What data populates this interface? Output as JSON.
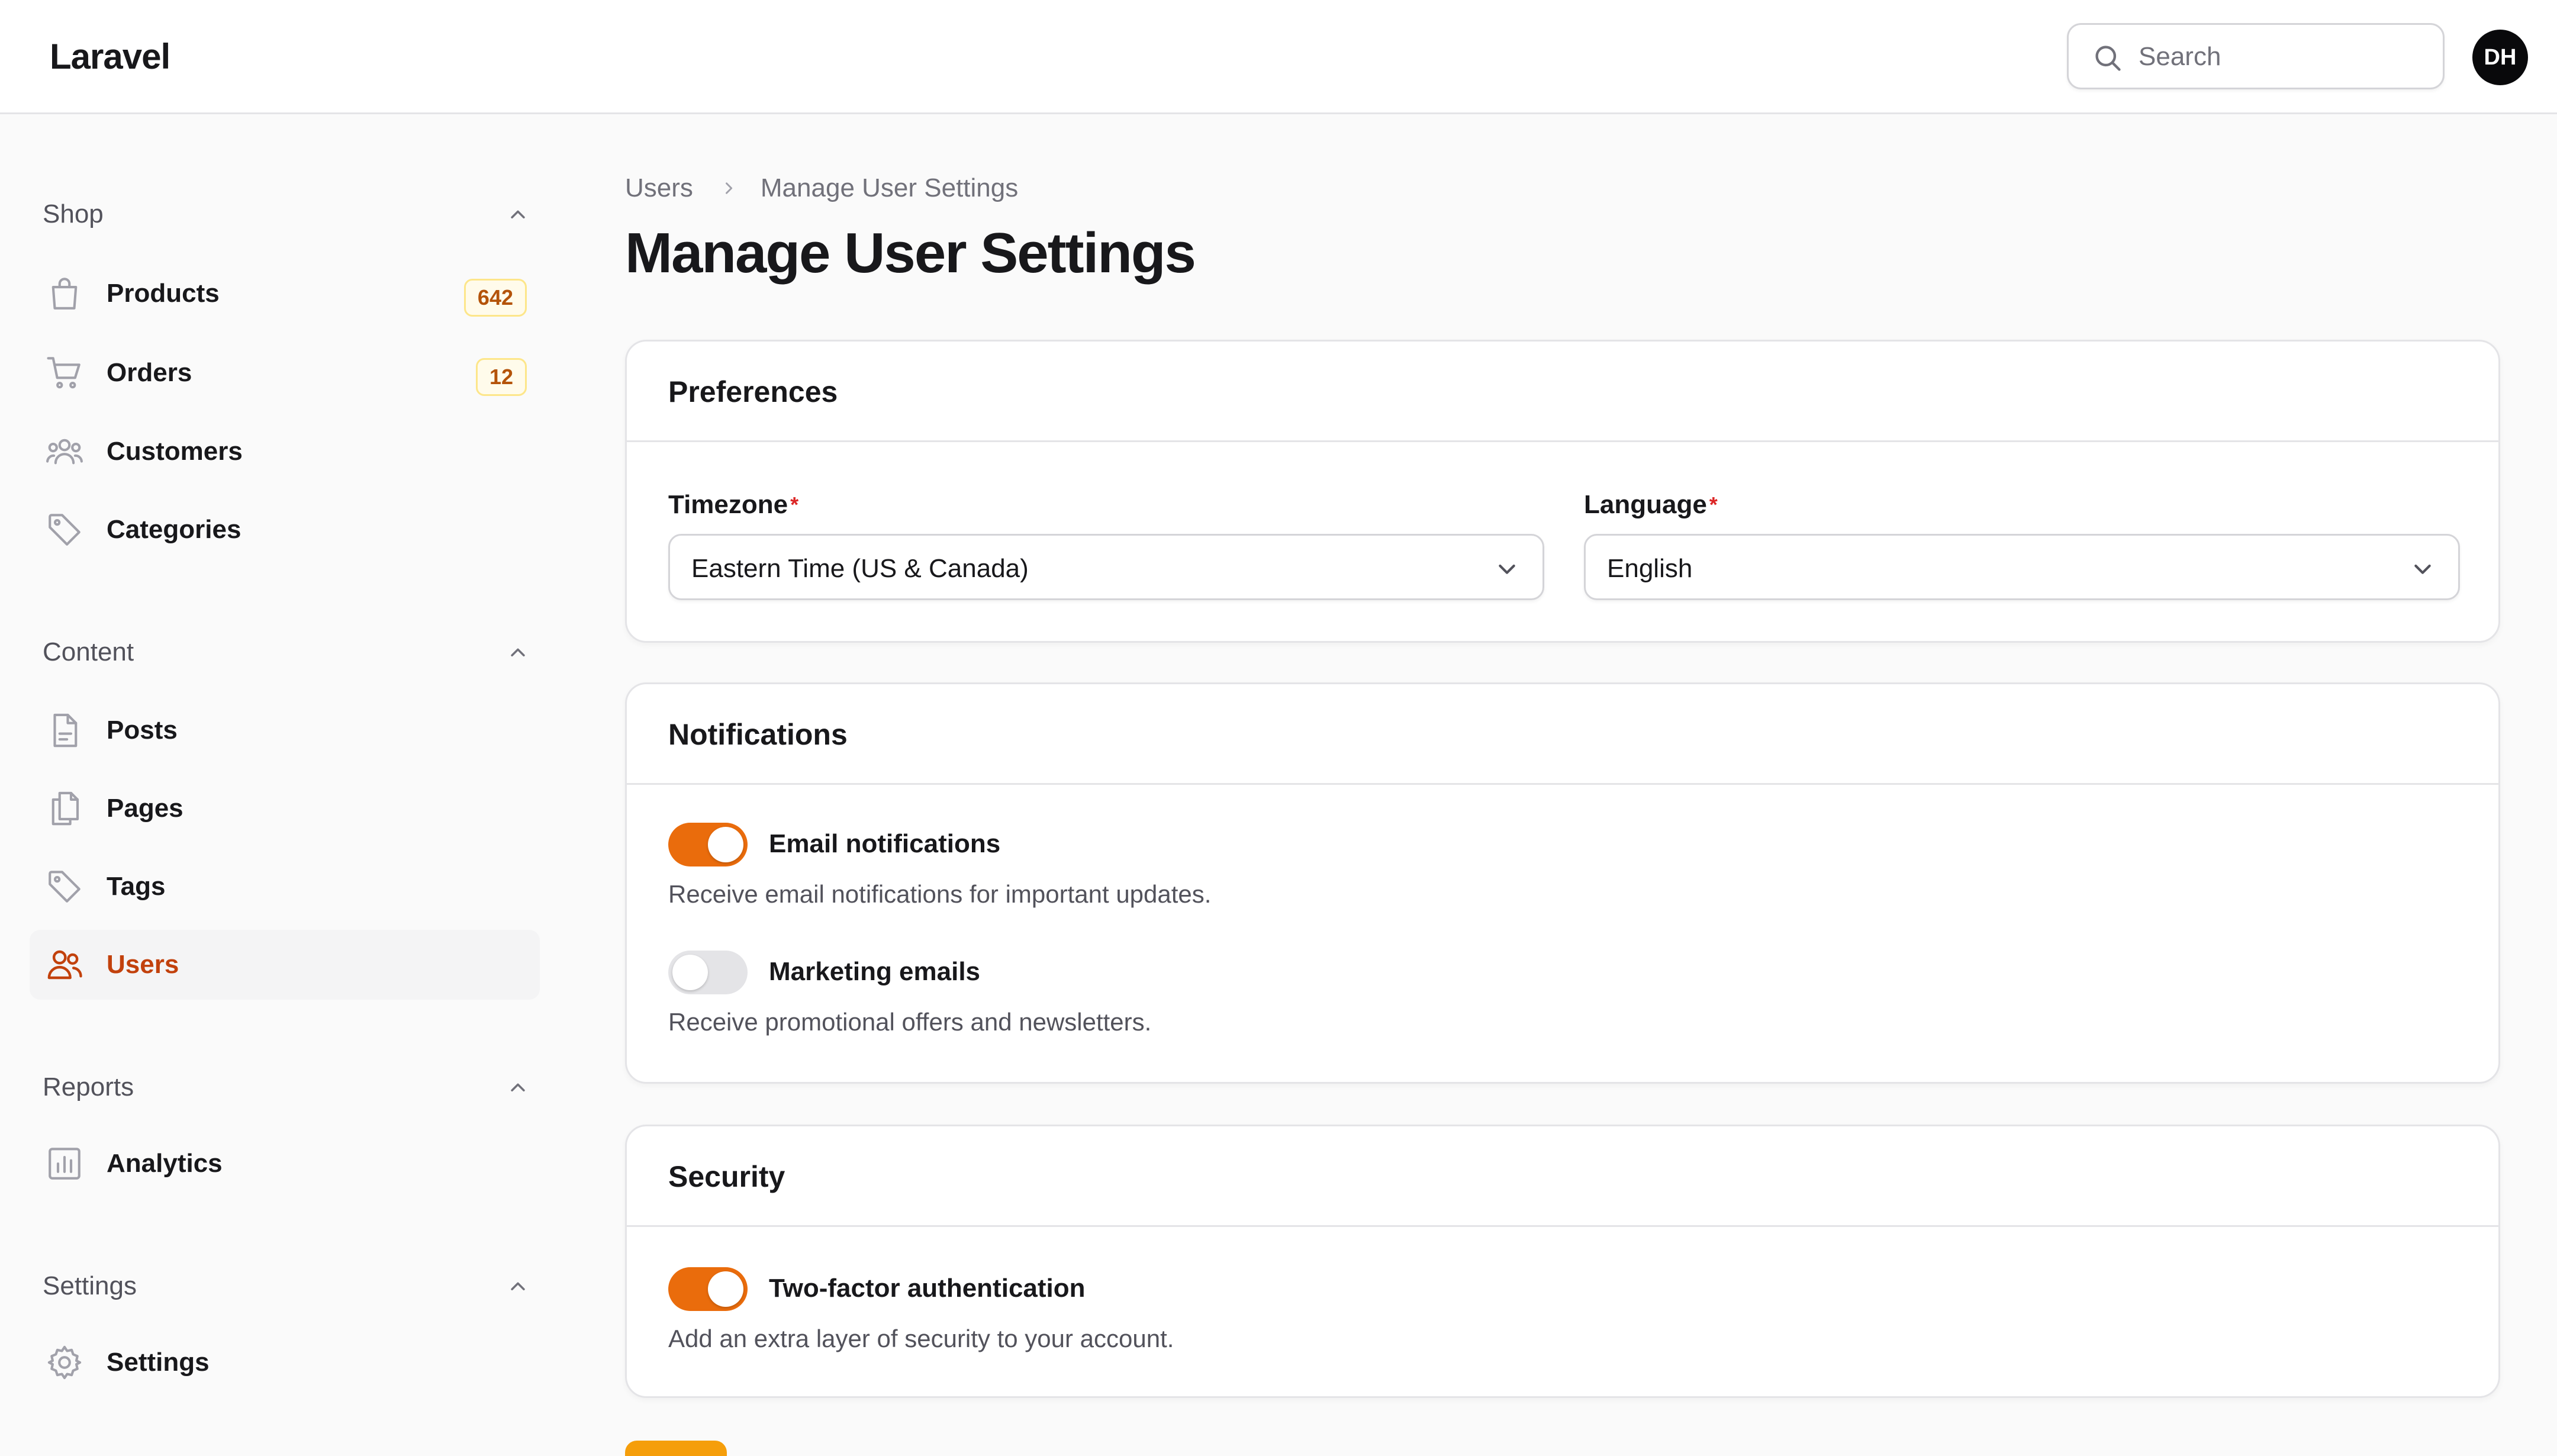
{
  "app": {
    "brand": "Laravel"
  },
  "topbar": {
    "search_placeholder": "Search",
    "avatar_initials": "DH"
  },
  "sidebar": {
    "groups": [
      {
        "label": "Shop",
        "items": [
          {
            "label": "Products",
            "badge": "642",
            "icon": "shopping-bag-icon"
          },
          {
            "label": "Orders",
            "badge": "12",
            "icon": "shopping-cart-icon"
          },
          {
            "label": "Customers",
            "icon": "users-group-icon"
          },
          {
            "label": "Categories",
            "icon": "tag-icon"
          }
        ]
      },
      {
        "label": "Content",
        "items": [
          {
            "label": "Posts",
            "icon": "document-icon"
          },
          {
            "label": "Pages",
            "icon": "documents-icon"
          },
          {
            "label": "Tags",
            "icon": "tag-icon"
          },
          {
            "label": "Users",
            "icon": "users-icon",
            "active": true
          }
        ]
      },
      {
        "label": "Reports",
        "items": [
          {
            "label": "Analytics",
            "icon": "chart-bar-icon"
          }
        ]
      },
      {
        "label": "Settings",
        "items": [
          {
            "label": "Settings",
            "icon": "gear-icon"
          }
        ]
      }
    ]
  },
  "breadcrumb": {
    "parent": "Users",
    "current": "Manage User Settings"
  },
  "page": {
    "title": "Manage User Settings"
  },
  "preferences": {
    "title": "Preferences",
    "timezone": {
      "label": "Timezone",
      "value": "Eastern Time (US & Canada)",
      "required_mark": "*"
    },
    "language": {
      "label": "Language",
      "value": "English",
      "required_mark": "*"
    }
  },
  "notifications": {
    "title": "Notifications",
    "email": {
      "label": "Email notifications",
      "description": "Receive email notifications for important updates.",
      "enabled": true
    },
    "marketing": {
      "label": "Marketing emails",
      "description": "Receive promotional offers and newsletters.",
      "enabled": false
    }
  },
  "security": {
    "title": "Security",
    "two_factor": {
      "label": "Two-factor authentication",
      "description": "Add an extra layer of security to your account.",
      "enabled": true
    }
  },
  "colors": {
    "accent": "#ea6c0c",
    "active_text": "#c2410c",
    "badge_bg": "#fffbeb",
    "badge_text": "#b45309",
    "button": "#f59e0b"
  }
}
